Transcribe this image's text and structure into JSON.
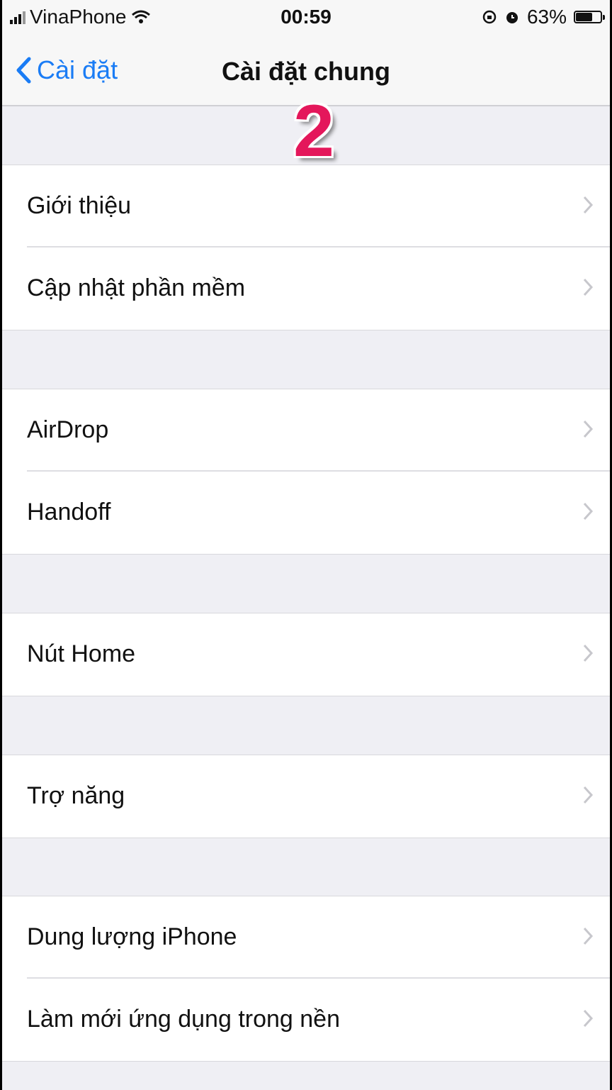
{
  "status_bar": {
    "carrier": "VinaPhone",
    "time": "00:59",
    "battery_percent": "63%",
    "battery_level": 0.63
  },
  "nav": {
    "back_label": "Cài đặt",
    "title": "Cài đặt chung"
  },
  "step_marker": "2",
  "colors": {
    "accent": "#1a7cf5",
    "marker": "#e4175b"
  },
  "groups": [
    {
      "items": [
        {
          "label": "Giới thiệu"
        },
        {
          "label": "Cập nhật phần mềm"
        }
      ]
    },
    {
      "items": [
        {
          "label": "AirDrop"
        },
        {
          "label": "Handoff"
        }
      ]
    },
    {
      "items": [
        {
          "label": "Nút Home"
        }
      ]
    },
    {
      "items": [
        {
          "label": "Trợ năng"
        }
      ]
    },
    {
      "items": [
        {
          "label": "Dung lượng iPhone"
        },
        {
          "label": "Làm mới ứng dụng trong nền"
        }
      ]
    }
  ]
}
